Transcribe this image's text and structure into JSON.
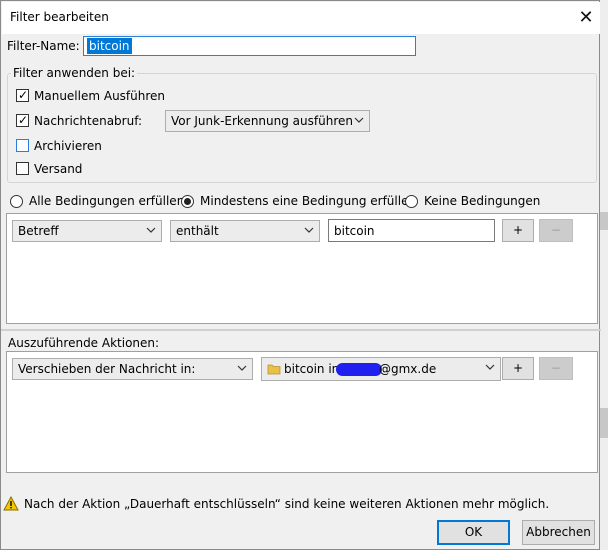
{
  "dialog": {
    "title": "Filter bearbeiten",
    "close_glyph": "✕"
  },
  "filter_name": {
    "label": "Filter-Name:",
    "value": "bitcoin"
  },
  "apply_group": {
    "legend": "Filter anwenden bei:",
    "manual_run": {
      "label": "Manuellem Ausführen",
      "checked": true
    },
    "on_fetch": {
      "label": "Nachrichtenabruf:",
      "checked": true
    },
    "fetch_mode_select": "Vor Junk-Erkennung ausführen",
    "archive": {
      "label": "Archivieren",
      "checked": false
    },
    "send": {
      "label": "Versand",
      "checked": false
    }
  },
  "match_mode": {
    "all": "Alle Bedingungen erfüllen",
    "any": "Mindestens eine Bedingung erfüllen",
    "none": "Keine Bedingungen",
    "selected": "any"
  },
  "condition": {
    "field": "Betreff",
    "operator": "enthält",
    "value": "bitcoin",
    "add_label": "+",
    "remove_label": "−"
  },
  "actions": {
    "header": "Auszuführende Aktionen:",
    "action_type": "Verschieben der Nachricht in:",
    "folder_name": "bitcoin in",
    "folder_domain": "@gmx.de",
    "add_label": "+",
    "remove_label": "−"
  },
  "warning": {
    "text": "Nach der Aktion „Dauerhaft entschlüsseln“ sind keine weiteren Aktionen mehr möglich.",
    "icon": "warning-triangle-icon"
  },
  "buttons": {
    "ok": "OK",
    "cancel": "Abbrechen"
  },
  "colors": {
    "accent": "#0078d7",
    "warning": "#f2c800",
    "folder": "#e8c04a"
  }
}
